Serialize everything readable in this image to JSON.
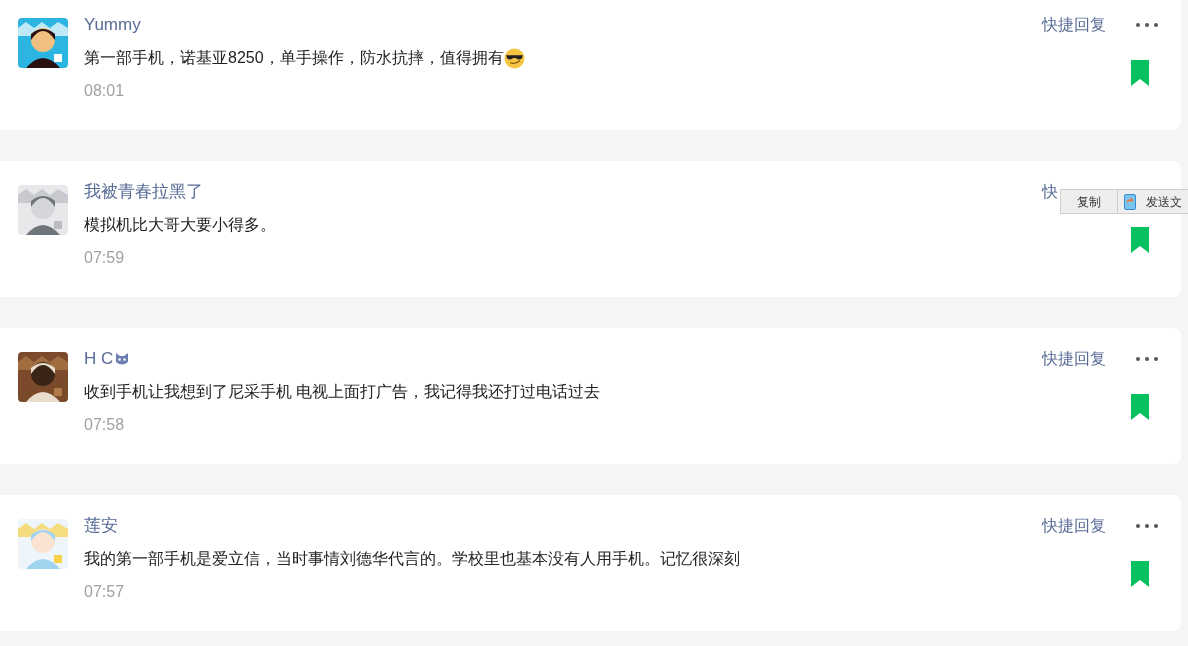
{
  "comments": [
    {
      "name": "Yummy",
      "name_badge": false,
      "text": "第一部手机，诺基亚8250，单手操作，防水抗摔，值得拥有",
      "trailing_emoji": true,
      "time": "08:01",
      "quick_reply": "快捷回复",
      "more_button": true,
      "bookmarked": true
    },
    {
      "name": "我被青春拉黑了",
      "name_badge": false,
      "text": "模拟机比大哥大要小得多。",
      "trailing_emoji": false,
      "time": "07:59",
      "quick_reply": "快",
      "more_button": false,
      "bookmarked": true,
      "context_menu": {
        "items": [
          "复制",
          "发送文"
        ]
      }
    },
    {
      "name": "H C",
      "name_badge": true,
      "text": "收到手机让我想到了尼采手机 电视上面打广告，我记得我还打过电话过去",
      "trailing_emoji": false,
      "time": "07:58",
      "quick_reply": "快捷回复",
      "more_button": true,
      "bookmarked": true
    },
    {
      "name": "莲安",
      "name_badge": false,
      "text": "我的第一部手机是爱立信，当时事情刘德华代言的。学校里也基本没有人用手机。记忆很深刻",
      "trailing_emoji": false,
      "time": "07:57",
      "quick_reply": "快捷回复",
      "more_button": true,
      "bookmarked": true
    }
  ]
}
